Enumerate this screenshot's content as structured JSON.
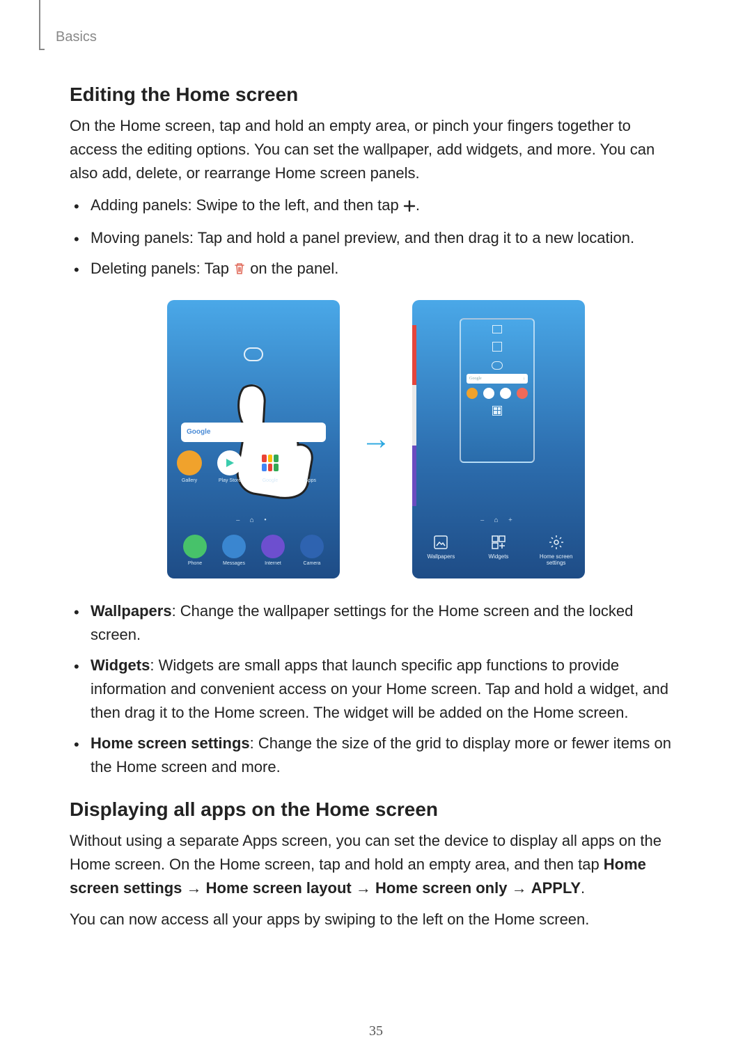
{
  "breadcrumb": "Basics",
  "page_number": "35",
  "section1": {
    "heading": "Editing the Home screen",
    "intro": "On the Home screen, tap and hold an empty area, or pinch your fingers together to access the editing options. You can set the wallpaper, add widgets, and more. You can also add, delete, or rearrange Home screen panels.",
    "bullets_simple": [
      "Adding panels: Swipe to the left, and then tap ",
      "Moving panels: Tap and hold a panel preview, and then drag it to a new location.",
      "Deleting panels: Tap "
    ],
    "bullet1_tail": ".",
    "bullet3_tail": " on the panel.",
    "bullets_bold": [
      {
        "bold": "Wallpapers",
        "rest": ": Change the wallpaper settings for the Home screen and the locked screen."
      },
      {
        "bold": "Widgets",
        "rest": ": Widgets are small apps that launch specific app functions to provide information and convenient access on your Home screen. Tap and hold a widget, and then drag it to the Home screen. The widget will be added on the Home screen."
      },
      {
        "bold": "Home screen settings",
        "rest": ": Change the size of the grid to display more or fewer items on the Home screen and more."
      }
    ]
  },
  "section2": {
    "heading": "Displaying all apps on the Home screen",
    "para1_pre": "Without using a separate Apps screen, you can set the device to display all apps on the Home screen. On the Home screen, tap and hold an empty area, and then tap ",
    "bold1": "Home screen settings",
    "arrow": " → ",
    "bold2": "Home screen layout",
    "bold3": "Home screen only",
    "bold4": "APPLY",
    "para1_tail": ".",
    "para2": "You can now access all your apps by swiping to the left on the Home screen."
  },
  "figure": {
    "left": {
      "search_placeholder": "Google",
      "apps": [
        {
          "label": "Gallery",
          "color": "#f0a22c"
        },
        {
          "label": "Play Store",
          "color": "#ffffff"
        },
        {
          "label": "Google",
          "color": "#ffffff"
        },
        {
          "label": "Apps",
          "color": "transparent"
        }
      ],
      "dock": [
        {
          "label": "Phone",
          "color": "#47c26a"
        },
        {
          "label": "Messages",
          "color": "#3a86d0"
        },
        {
          "label": "Internet",
          "color": "#6d4fcf"
        },
        {
          "label": "Camera",
          "color": "#2e63b0"
        }
      ]
    },
    "right": {
      "search_placeholder": "Google",
      "bottom": [
        {
          "label": "Wallpapers"
        },
        {
          "label": "Widgets"
        },
        {
          "label": "Home screen settings"
        }
      ]
    }
  }
}
